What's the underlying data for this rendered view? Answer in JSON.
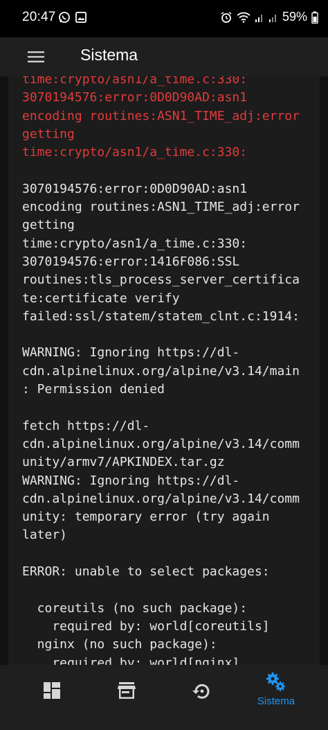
{
  "status_bar": {
    "time": "20:47",
    "battery": "59%",
    "left_icons": [
      "whatsapp-icon",
      "gallery-icon"
    ],
    "right_icons": [
      "alarm-icon",
      "wifi-icon",
      "signal-icon",
      "signal-icon",
      "battery-icon"
    ]
  },
  "app_bar": {
    "title": "Sistema",
    "menu_icon": "hamburger-menu-icon"
  },
  "log": {
    "error_lines": [
      "time:crypto/asn1/a_time.c:330:",
      "3070194576:error:0D0D90AD:asn1",
      "encoding routines:ASN1_TIME_adj:error",
      "getting",
      "time:crypto/asn1/a_time.c:330:"
    ],
    "lines": [
      "",
      "3070194576:error:0D0D90AD:asn1",
      "encoding routines:ASN1_TIME_adj:error",
      "getting",
      "time:crypto/asn1/a_time.c:330:",
      "3070194576:error:1416F086:SSL",
      "routines:tls_process_server_certifica",
      "te:certificate verify",
      "failed:ssl/statem/statem_clnt.c:1914:",
      "",
      "WARNING: Ignoring https://dl-",
      "cdn.alpinelinux.org/alpine/v3.14/main",
      ": Permission denied",
      "",
      "fetch https://dl-",
      "cdn.alpinelinux.org/alpine/v3.14/comm",
      "unity/armv7/APKINDEX.tar.gz",
      "WARNING: Ignoring https://dl-",
      "cdn.alpinelinux.org/alpine/v3.14/comm",
      "unity: temporary error (try again",
      "later)",
      "",
      "ERROR: unable to select packages:",
      "",
      "  coreutils (no such package):",
      "    required by: world[coreutils]",
      "  nginx (no such package):",
      "    required by: world[nginx]"
    ]
  },
  "bottom_nav": {
    "items": [
      {
        "icon": "dashboard-icon",
        "label": ""
      },
      {
        "icon": "store-icon",
        "label": ""
      },
      {
        "icon": "restore-icon",
        "label": ""
      },
      {
        "icon": "settings-gears-icon",
        "label": "Sistema",
        "active": true
      }
    ]
  },
  "colors": {
    "error_text": "#e23b3b",
    "log_text": "#e6e6e6",
    "accent": "#2196f3",
    "app_bar_bg": "#1f1f1f",
    "content_bg": "#1c1c1c"
  }
}
